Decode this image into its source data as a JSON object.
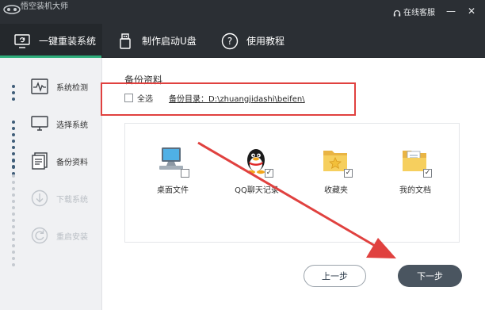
{
  "window": {
    "title": "悟空装机大师",
    "online_help": "在线客服",
    "minimize_glyph": "—",
    "close_glyph": "✕"
  },
  "topnav": {
    "items": [
      {
        "label": "一键重装系统",
        "icon": "reinstall-icon",
        "active": true
      },
      {
        "label": "制作启动U盘",
        "icon": "usb-icon",
        "active": false
      },
      {
        "label": "使用教程",
        "icon": "help-icon",
        "active": false
      }
    ],
    "accent_color": "#2fae7c"
  },
  "sidebar": {
    "steps": [
      {
        "label": "系统检测",
        "icon": "system-check-icon",
        "enabled": true
      },
      {
        "label": "选择系统",
        "icon": "monitor-icon",
        "enabled": true
      },
      {
        "label": "备份资料",
        "icon": "backup-icon",
        "enabled": true
      },
      {
        "label": "下载系统",
        "icon": "download-icon",
        "enabled": false
      },
      {
        "label": "重启安装",
        "icon": "restart-icon",
        "enabled": false
      }
    ]
  },
  "main": {
    "section_title": "备份资料",
    "select_all": {
      "label": "全选",
      "checked": false
    },
    "backup_dir": "备份目录：D:\\zhuangjidashi\\beifen\\",
    "items": [
      {
        "label": "桌面文件",
        "icon": "desktop-computer-icon",
        "checked": false
      },
      {
        "label": "QQ聊天记录",
        "icon": "qq-penguin-icon",
        "checked": true
      },
      {
        "label": "收藏夹",
        "icon": "favorites-folder-icon",
        "checked": true
      },
      {
        "label": "我的文档",
        "icon": "my-documents-icon",
        "checked": true
      }
    ],
    "prev_button": "上一步",
    "next_button": "下一步"
  },
  "colors": {
    "titlebar": "#2b2f34",
    "annotation_red": "#e0413f",
    "next_button": "#4a5560"
  }
}
